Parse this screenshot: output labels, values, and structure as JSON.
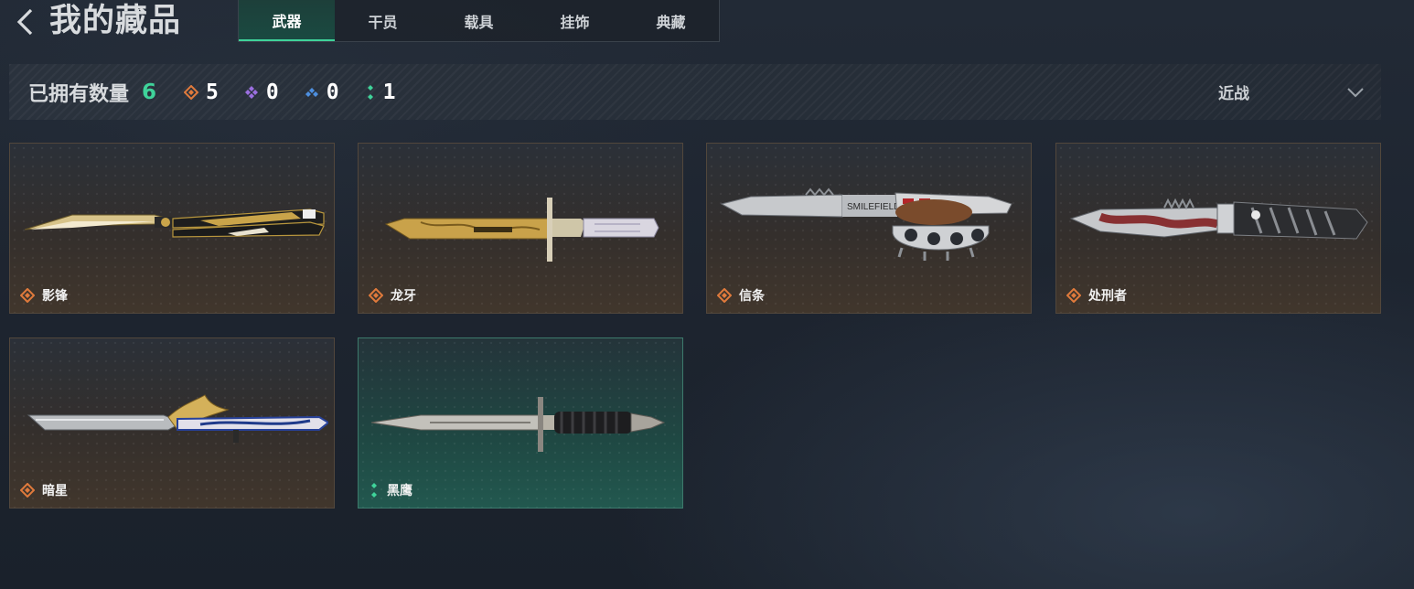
{
  "header": {
    "title": "我的藏品",
    "tabs": [
      {
        "label": "武器",
        "active": true
      },
      {
        "label": "干员",
        "active": false
      },
      {
        "label": "载具",
        "active": false
      },
      {
        "label": "挂饰",
        "active": false
      },
      {
        "label": "典藏",
        "active": false
      }
    ]
  },
  "summary": {
    "owned_label": "已拥有数量",
    "owned_count": "6",
    "rarities": [
      {
        "icon": "orange-diamond-icon",
        "color": "#e07a3c",
        "count": "5"
      },
      {
        "icon": "purple-diamond-icon",
        "color": "#9b6fe0",
        "count": "0"
      },
      {
        "icon": "blue-diamond-icon",
        "color": "#4d8fe0",
        "count": "0"
      },
      {
        "icon": "green-diamond-icon",
        "color": "#3fd39a",
        "count": "1"
      }
    ],
    "filter": {
      "selected": "近战",
      "icon": "chevron-down-icon"
    }
  },
  "items": [
    {
      "name": "影锋",
      "rarity": "orange",
      "icon": "butterfly-knife-icon"
    },
    {
      "name": "龙牙",
      "rarity": "orange",
      "icon": "bayonet-knife-icon"
    },
    {
      "name": "信条",
      "rarity": "orange",
      "icon": "knuckle-knife-icon",
      "engraving": "SMILEFIELD"
    },
    {
      "name": "处刑者",
      "rarity": "orange",
      "icon": "serrated-knife-icon"
    },
    {
      "name": "暗星",
      "rarity": "orange",
      "icon": "eagle-dagger-icon"
    },
    {
      "name": "黑鹰",
      "rarity": "green",
      "icon": "combat-dagger-icon"
    }
  ],
  "colors": {
    "accent": "#3fd39a",
    "orange": "#e07a3c",
    "gold": "#d4b15a"
  }
}
